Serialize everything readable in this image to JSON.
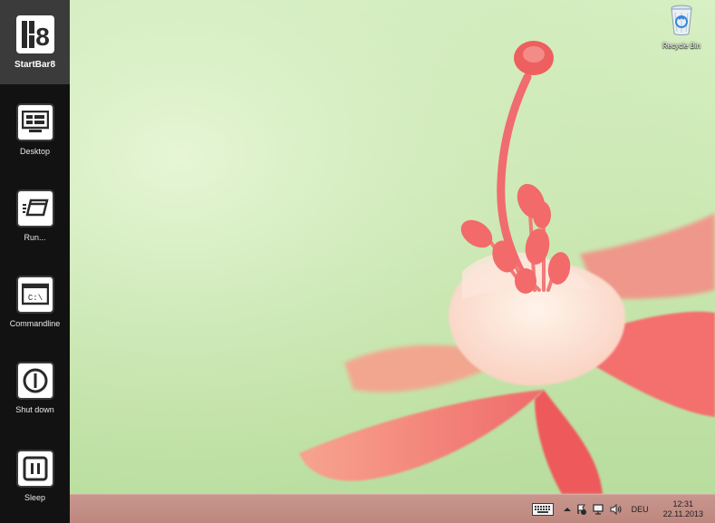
{
  "sidebar": {
    "start": {
      "label": "StartBar8",
      "logo_text": "8"
    },
    "items": [
      {
        "label": "Desktop",
        "icon": "desktop-icon"
      },
      {
        "label": "Run...",
        "icon": "run-icon"
      },
      {
        "label": "Commandline",
        "icon": "commandline-icon",
        "glyph": "C:\\"
      },
      {
        "label": "Shut down",
        "icon": "power-icon"
      },
      {
        "label": "Sleep",
        "icon": "pause-icon"
      }
    ]
  },
  "desktop": {
    "icons": [
      {
        "label": "Recycle Bin",
        "icon": "recycle-bin-icon"
      }
    ]
  },
  "taskbar": {
    "tray": {
      "keyboard_icon": "keyboard-icon",
      "overflow_icon": "chevron-up-icon",
      "flag_icon": "action-center-icon",
      "network_icon": "network-icon",
      "volume_icon": "volume-icon",
      "language": "DEU",
      "time": "12:31",
      "date": "22.11.2013"
    }
  },
  "colors": {
    "sidebar_bg": "#121212",
    "start_bg": "#3b3b3b",
    "taskbar_bg": "#c08a82",
    "flower": "#f0706c"
  }
}
